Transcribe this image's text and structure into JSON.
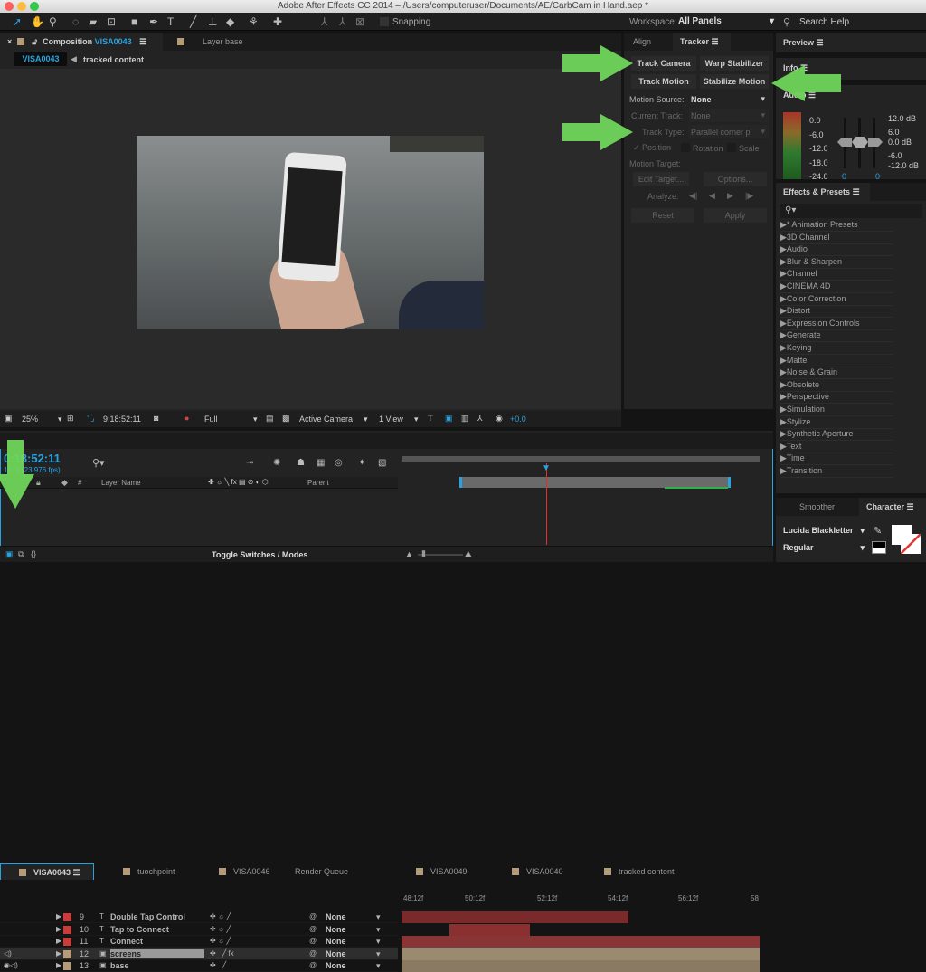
{
  "window": {
    "title": "Adobe After Effects CC 2014 – /Users/computeruser/Documents/AE/CarbCam in Hand.aep *"
  },
  "toolbar": {
    "snapping": "Snapping",
    "workspace_label": "Workspace:",
    "workspace_value": "All Panels",
    "search_help": "Search Help"
  },
  "composition_panel": {
    "tabs": [
      {
        "label": "Composition",
        "comp": "VISA0043"
      },
      {
        "label": "Layer base"
      }
    ],
    "breadcrumb": [
      "VISA0043",
      "tracked content"
    ],
    "footer": {
      "zoom": "25%",
      "timecode": "9:18:52:11",
      "resolution": "Full",
      "camera": "Active Camera",
      "view": "1 View",
      "exposure": "+0.0"
    }
  },
  "tracker": {
    "tabs": [
      "Align",
      "Tracker"
    ],
    "buttons": [
      "Track Camera",
      "Warp Stabilizer",
      "Track Motion",
      "Stabilize Motion"
    ],
    "motion_source_label": "Motion Source:",
    "motion_source": "None",
    "current_track_label": "Current Track:",
    "current_track": "None",
    "track_type_label": "Track Type:",
    "track_type": "Parallel corner pi",
    "position": "Position",
    "rotation": "Rotation",
    "scale": "Scale",
    "motion_target_label": "Motion Target:",
    "edit_target": "Edit Target...",
    "options": "Options...",
    "analyze_label": "Analyze:",
    "reset": "Reset",
    "apply": "Apply"
  },
  "preview": {
    "title": "Preview"
  },
  "info": {
    "title": "Info"
  },
  "audio": {
    "title": "Audio",
    "left_scale": [
      "0.0",
      "-6.0",
      "-12.0",
      "-18.0",
      "-24.0"
    ],
    "right_scale": [
      "12.0 dB",
      "6.0",
      "0.0 dB",
      "-6.0",
      "-12.0 dB"
    ],
    "levels": [
      "0",
      "0"
    ]
  },
  "effects": {
    "title": "Effects & Presets",
    "items": [
      "* Animation Presets",
      "3D Channel",
      "Audio",
      "Blur & Sharpen",
      "Channel",
      "CINEMA 4D",
      "Color Correction",
      "Distort",
      "Expression Controls",
      "Generate",
      "Keying",
      "Matte",
      "Noise & Grain",
      "Obsolete",
      "Perspective",
      "Simulation",
      "Stylize",
      "Synthetic Aperture",
      "Text",
      "Time",
      "Transition"
    ]
  },
  "character": {
    "tabs": [
      "Smoother",
      "Character"
    ],
    "font": "Lucida Blackletter",
    "style": "Regular"
  },
  "timeline": {
    "tabs": [
      "VISA0043",
      "tuochpoint",
      "VISA0046",
      "Render Queue",
      "VISA0049",
      "VISA0040",
      "tracked content"
    ],
    "timecode": "0:18:52:11",
    "frames": "1779 (23.976 fps)",
    "columns": {
      "num": "#",
      "name": "Layer Name",
      "parent": "Parent"
    },
    "ruler": [
      "48:12f",
      "50:12f",
      "52:12f",
      "54:12f",
      "56:12f",
      "58"
    ],
    "layers": [
      {
        "num": "9",
        "name": "Double Tap Control",
        "parent": "None",
        "color": "#c83c3c",
        "type": "text"
      },
      {
        "num": "10",
        "name": "Tap to Connect",
        "parent": "None",
        "color": "#c83c3c",
        "type": "text"
      },
      {
        "num": "11",
        "name": "Connect",
        "parent": "None",
        "color": "#c83c3c",
        "type": "text"
      },
      {
        "num": "12",
        "name": "screens",
        "parent": "None",
        "color": "#b69b78",
        "type": "footage"
      },
      {
        "num": "13",
        "name": "base",
        "parent": "None",
        "color": "#b69b78",
        "type": "footage"
      }
    ],
    "toggle": "Toggle Switches / Modes"
  },
  "colors": {
    "accent": "#29a3e0",
    "arrow": "#6fd65a",
    "playhead": "#e03030"
  }
}
